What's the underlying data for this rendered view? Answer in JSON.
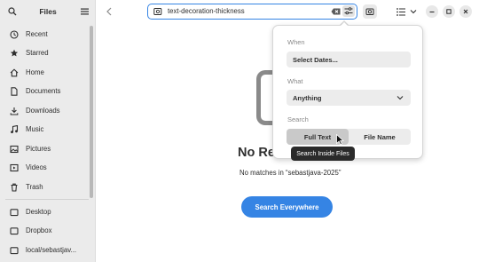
{
  "sidebar": {
    "title": "Files",
    "search_icon": "search-icon",
    "menu_icon": "hamburger-menu-icon",
    "items": [
      {
        "label": "Recent",
        "icon": "clock-icon"
      },
      {
        "label": "Starred",
        "icon": "star-icon"
      },
      {
        "label": "Home",
        "icon": "home-icon"
      },
      {
        "label": "Documents",
        "icon": "document-icon"
      },
      {
        "label": "Downloads",
        "icon": "download-icon"
      },
      {
        "label": "Music",
        "icon": "music-icon"
      },
      {
        "label": "Pictures",
        "icon": "picture-icon"
      },
      {
        "label": "Videos",
        "icon": "video-icon"
      },
      {
        "label": "Trash",
        "icon": "trash-icon"
      },
      {
        "label": "Desktop",
        "icon": "folder-icon"
      },
      {
        "label": "Dropbox",
        "icon": "folder-icon"
      },
      {
        "label": "local/sebastjav...",
        "icon": "folder-icon"
      }
    ]
  },
  "header": {
    "search_query": "text-decoration-thickness",
    "back_icon": "chevron-left-icon",
    "clear_icon": "clear-text-icon",
    "filter_icon": "search-filter-icon",
    "buttons": [
      "new-folder-icon",
      "view-list-icon",
      "chevron-down-icon",
      "minimize-icon",
      "maximize-icon",
      "close-icon"
    ]
  },
  "main": {
    "empty_title": "No Results Found",
    "empty_subtitle": "No matches in “sebastjava-2025”",
    "search_everywhere_label": "Search Everywhere"
  },
  "popover": {
    "when_label": "When",
    "when_value": "Select Dates...",
    "what_label": "What",
    "what_value": "Anything",
    "search_label": "Search",
    "full_text_label": "Full Text",
    "file_name_label": "File Name",
    "tooltip": "Search Inside Files"
  },
  "colors": {
    "accent": "#3584e4",
    "sidebar_bg": "#ebebeb",
    "tooltip_bg": "#2b2b2b"
  }
}
